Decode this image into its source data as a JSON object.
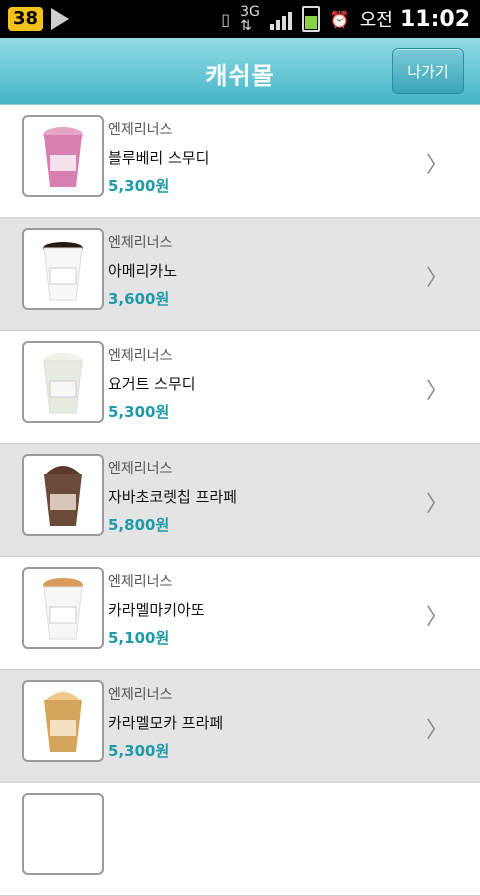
{
  "status": {
    "notification_count": "38",
    "time_ampm": "오전",
    "time": "11:02"
  },
  "header": {
    "title": "캐쉬몰",
    "exit_label": "나가기"
  },
  "items": [
    {
      "shop": "엔제리너스",
      "name": "블루베리 스무디",
      "price": "5,300원",
      "drink": "pink"
    },
    {
      "shop": "엔제리너스",
      "name": "아메리카노",
      "price": "3,600원",
      "drink": "coffee"
    },
    {
      "shop": "엔제리너스",
      "name": "요거트 스무디",
      "price": "5,300원",
      "drink": "white"
    },
    {
      "shop": "엔제리너스",
      "name": "자바초코렛칩 프라페",
      "price": "5,800원",
      "drink": "chocolate"
    },
    {
      "shop": "엔제리너스",
      "name": "카라멜마키아또",
      "price": "5,100원",
      "drink": "caramel-macchiato"
    },
    {
      "shop": "엔제리너스",
      "name": "카라멜모카 프라페",
      "price": "5,300원",
      "drink": "caramel-mocha"
    }
  ]
}
